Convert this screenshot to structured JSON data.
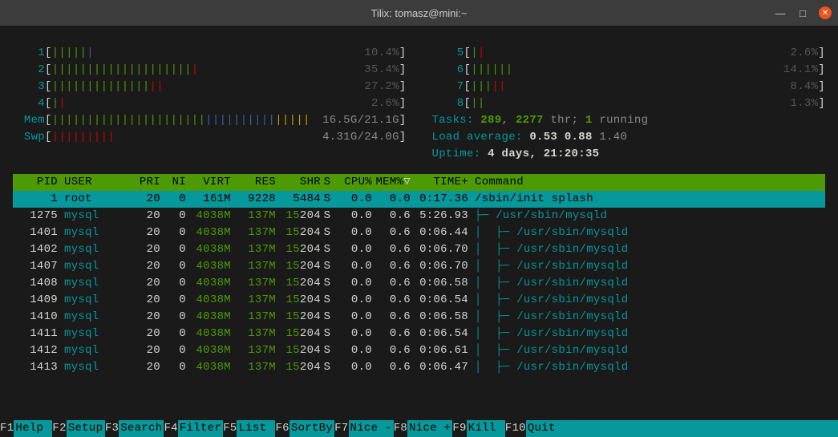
{
  "window": {
    "title": "Tilix: tomasz@mini:~"
  },
  "cpus": [
    {
      "label": "1",
      "pct": "10.4%",
      "ticks": "gggggb"
    },
    {
      "label": "2",
      "pct": "35.4%",
      "ticks": "ggggggggggggggggggggr"
    },
    {
      "label": "3",
      "pct": "27.2%",
      "ticks": "ggggggggggggggrr"
    },
    {
      "label": "4",
      "pct": "2.6%",
      "ticks": "gr"
    },
    {
      "label": "5",
      "pct": "2.6%",
      "ticks": "gr"
    },
    {
      "label": "6",
      "pct": "14.1%",
      "ticks": "gggggg"
    },
    {
      "label": "7",
      "pct": "8.4%",
      "ticks": "gggrr"
    },
    {
      "label": "8",
      "pct": "1.3%",
      "ticks": "gg"
    }
  ],
  "mem": {
    "label": "Mem",
    "used": "16.5G",
    "total": "21.1G",
    "ticks": "ggggggggggggggggggggggbbbbbbbbbbyyyyy"
  },
  "swp": {
    "label": "Swp",
    "used": "4.31G",
    "total": "24.0G",
    "ticks": "rrrrrrrrr"
  },
  "tasks": {
    "label": "Tasks: ",
    "procs": "289",
    "sep1": ", ",
    "thr": "2277",
    "thr_lbl": " thr; ",
    "run": "1",
    "run_lbl": " running"
  },
  "load": {
    "label": "Load average: ",
    "v1": "0.53",
    "v2": "0.88",
    "v3": "1.40"
  },
  "uptime": {
    "label": "Uptime: ",
    "value": "4 days, 21:20:35"
  },
  "headers": {
    "pid": "PID",
    "user": "USER",
    "pri": "PRI",
    "ni": "NI",
    "virt": "VIRT",
    "res": "RES",
    "shr": "SHR",
    "s": "S",
    "cpu": "CPU%",
    "mem": "MEM%",
    "time": "TIME+",
    "cmd": "Command",
    "arrow": "▽"
  },
  "procs": [
    {
      "pid": "1",
      "user": "root",
      "pri": "20",
      "ni": "0",
      "virt": "161M",
      "res": "9228",
      "shr1": "54",
      "shr2": "84",
      "s": "S",
      "cpu": "0.0",
      "mem": "0.0",
      "time": "0:17.36",
      "tree": "",
      "cmd": "/sbin/init splash",
      "sel": true,
      "virt_green": false,
      "res_green": false
    },
    {
      "pid": "1275",
      "user": "mysql",
      "pri": "20",
      "ni": "0",
      "virt": "4038M",
      "res": "137M",
      "shr1": "15",
      "shr2": "204",
      "s": "S",
      "cpu": "0.0",
      "mem": "0.6",
      "time": "5:26.93",
      "tree": "├─ ",
      "cmd": "/usr/sbin/mysqld",
      "virt_green": true,
      "res_green": true
    },
    {
      "pid": "1401",
      "user": "mysql",
      "pri": "20",
      "ni": "0",
      "virt": "4038M",
      "res": "137M",
      "shr1": "15",
      "shr2": "204",
      "s": "S",
      "cpu": "0.0",
      "mem": "0.6",
      "time": "0:06.44",
      "tree": "│  ├─ ",
      "cmd": "/usr/sbin/mysqld",
      "virt_green": true,
      "res_green": true
    },
    {
      "pid": "1402",
      "user": "mysql",
      "pri": "20",
      "ni": "0",
      "virt": "4038M",
      "res": "137M",
      "shr1": "15",
      "shr2": "204",
      "s": "S",
      "cpu": "0.0",
      "mem": "0.6",
      "time": "0:06.70",
      "tree": "│  ├─ ",
      "cmd": "/usr/sbin/mysqld",
      "virt_green": true,
      "res_green": true
    },
    {
      "pid": "1407",
      "user": "mysql",
      "pri": "20",
      "ni": "0",
      "virt": "4038M",
      "res": "137M",
      "shr1": "15",
      "shr2": "204",
      "s": "S",
      "cpu": "0.0",
      "mem": "0.6",
      "time": "0:06.70",
      "tree": "│  ├─ ",
      "cmd": "/usr/sbin/mysqld",
      "virt_green": true,
      "res_green": true
    },
    {
      "pid": "1408",
      "user": "mysql",
      "pri": "20",
      "ni": "0",
      "virt": "4038M",
      "res": "137M",
      "shr1": "15",
      "shr2": "204",
      "s": "S",
      "cpu": "0.0",
      "mem": "0.6",
      "time": "0:06.58",
      "tree": "│  ├─ ",
      "cmd": "/usr/sbin/mysqld",
      "virt_green": true,
      "res_green": true
    },
    {
      "pid": "1409",
      "user": "mysql",
      "pri": "20",
      "ni": "0",
      "virt": "4038M",
      "res": "137M",
      "shr1": "15",
      "shr2": "204",
      "s": "S",
      "cpu": "0.0",
      "mem": "0.6",
      "time": "0:06.54",
      "tree": "│  ├─ ",
      "cmd": "/usr/sbin/mysqld",
      "virt_green": true,
      "res_green": true
    },
    {
      "pid": "1410",
      "user": "mysql",
      "pri": "20",
      "ni": "0",
      "virt": "4038M",
      "res": "137M",
      "shr1": "15",
      "shr2": "204",
      "s": "S",
      "cpu": "0.0",
      "mem": "0.6",
      "time": "0:06.58",
      "tree": "│  ├─ ",
      "cmd": "/usr/sbin/mysqld",
      "virt_green": true,
      "res_green": true
    },
    {
      "pid": "1411",
      "user": "mysql",
      "pri": "20",
      "ni": "0",
      "virt": "4038M",
      "res": "137M",
      "shr1": "15",
      "shr2": "204",
      "s": "S",
      "cpu": "0.0",
      "mem": "0.6",
      "time": "0:06.54",
      "tree": "│  ├─ ",
      "cmd": "/usr/sbin/mysqld",
      "virt_green": true,
      "res_green": true
    },
    {
      "pid": "1412",
      "user": "mysql",
      "pri": "20",
      "ni": "0",
      "virt": "4038M",
      "res": "137M",
      "shr1": "15",
      "shr2": "204",
      "s": "S",
      "cpu": "0.0",
      "mem": "0.6",
      "time": "0:06.61",
      "tree": "│  ├─ ",
      "cmd": "/usr/sbin/mysqld",
      "virt_green": true,
      "res_green": true
    },
    {
      "pid": "1413",
      "user": "mysql",
      "pri": "20",
      "ni": "0",
      "virt": "4038M",
      "res": "137M",
      "shr1": "15",
      "shr2": "204",
      "s": "S",
      "cpu": "0.0",
      "mem": "0.6",
      "time": "0:06.47",
      "tree": "│  ├─ ",
      "cmd": "/usr/sbin/mysqld",
      "virt_green": true,
      "res_green": true
    }
  ],
  "fkeys": [
    {
      "key": "F1",
      "label": "Help  "
    },
    {
      "key": "F2",
      "label": "Setup "
    },
    {
      "key": "F3",
      "label": "Search"
    },
    {
      "key": "F4",
      "label": "Filter"
    },
    {
      "key": "F5",
      "label": "List  "
    },
    {
      "key": "F6",
      "label": "SortBy"
    },
    {
      "key": "F7",
      "label": "Nice -"
    },
    {
      "key": "F8",
      "label": "Nice +"
    },
    {
      "key": "F9",
      "label": "Kill  "
    },
    {
      "key": "F10",
      "label": "Quit  "
    }
  ]
}
